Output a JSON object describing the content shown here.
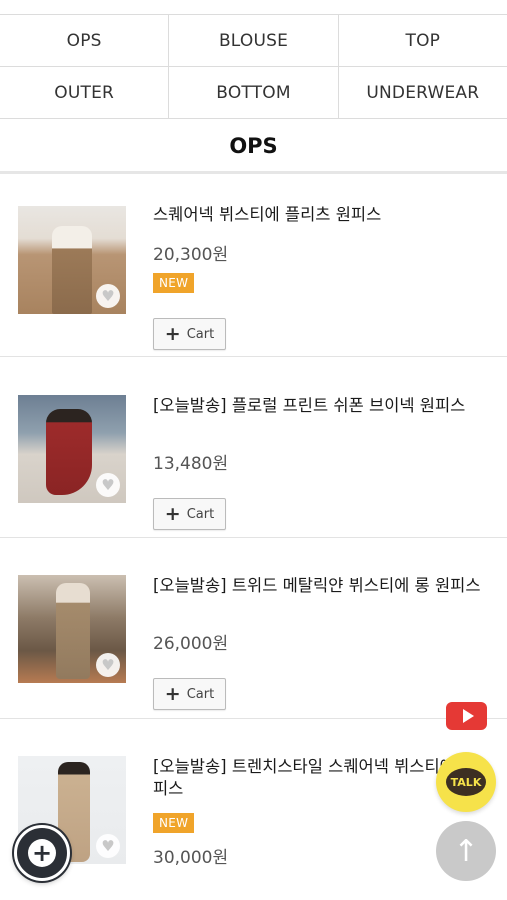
{
  "categories": [
    [
      "OPS",
      "BLOUSE",
      "TOP"
    ],
    [
      "OUTER",
      "BOTTOM",
      "UNDERWEAR"
    ]
  ],
  "section_title": "OPS",
  "products": [
    {
      "name": "스퀘어넥 뷔스티에 플리츠 원피스",
      "price": "20,300원",
      "badge": "NEW",
      "cart_label": "Cart"
    },
    {
      "name": "[오늘발송] 플로럴 프린트 쉬폰 브이넥 원피스",
      "price": "13,480원",
      "badge": "",
      "cart_label": "Cart"
    },
    {
      "name": "[오늘발송] 트위드 메탈릭얀 뷔스티에 롱 원피스",
      "price": "26,000원",
      "badge": "",
      "cart_label": "Cart"
    },
    {
      "name": "[오늘발송] 트렌치스타일 스퀘어넥 뷔스티에 원피스",
      "price": "30,000원",
      "badge": "NEW",
      "cart_label": ""
    }
  ],
  "floating": {
    "talk_label": "TALK",
    "icons": [
      "youtube-icon",
      "kakaotalk-icon",
      "arrow-up-icon",
      "plus-icon",
      "heart-icon"
    ]
  },
  "colors": {
    "badge": "#f0a42a",
    "youtube": "#e53935",
    "talk": "#f6e24a",
    "fab": "#2b2f36"
  }
}
